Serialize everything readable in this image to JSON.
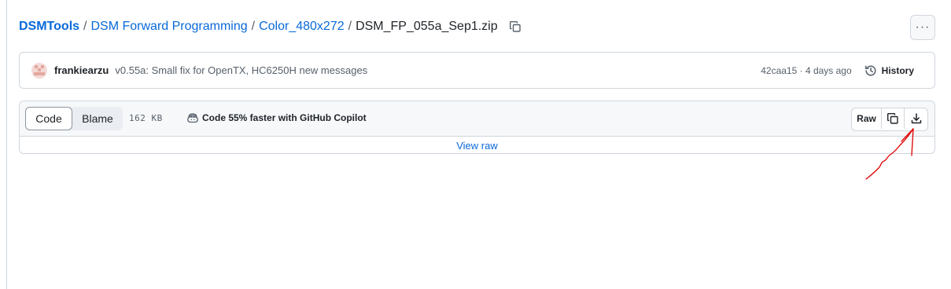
{
  "breadcrumb": {
    "repo": "DSMTools",
    "folder1": "DSM Forward Programming",
    "folder2": "Color_480x272",
    "file": "DSM_FP_055a_Sep1.zip",
    "separator": "/"
  },
  "more_menu": {
    "label": "···"
  },
  "commit": {
    "author": "frankiearzu",
    "message": "v0.55a: Small fix for OpenTX, HC6250H new messages",
    "meta": "42caa15 · 4 days ago",
    "history_label": "History"
  },
  "file_header": {
    "tab_code": "Code",
    "tab_blame": "Blame",
    "size": "162 KB",
    "copilot_promo": "Code 55% faster with GitHub Copilot",
    "raw_label": "Raw",
    "view_raw_link": "View raw"
  },
  "colors": {
    "link": "#0969da",
    "annotation": "#e00000",
    "border": "#d0d7de"
  },
  "icons": {
    "copy_path": "copy-icon",
    "history": "history-icon",
    "copilot": "copilot-icon",
    "copy_raw": "copy-icon",
    "download": "download-icon"
  }
}
